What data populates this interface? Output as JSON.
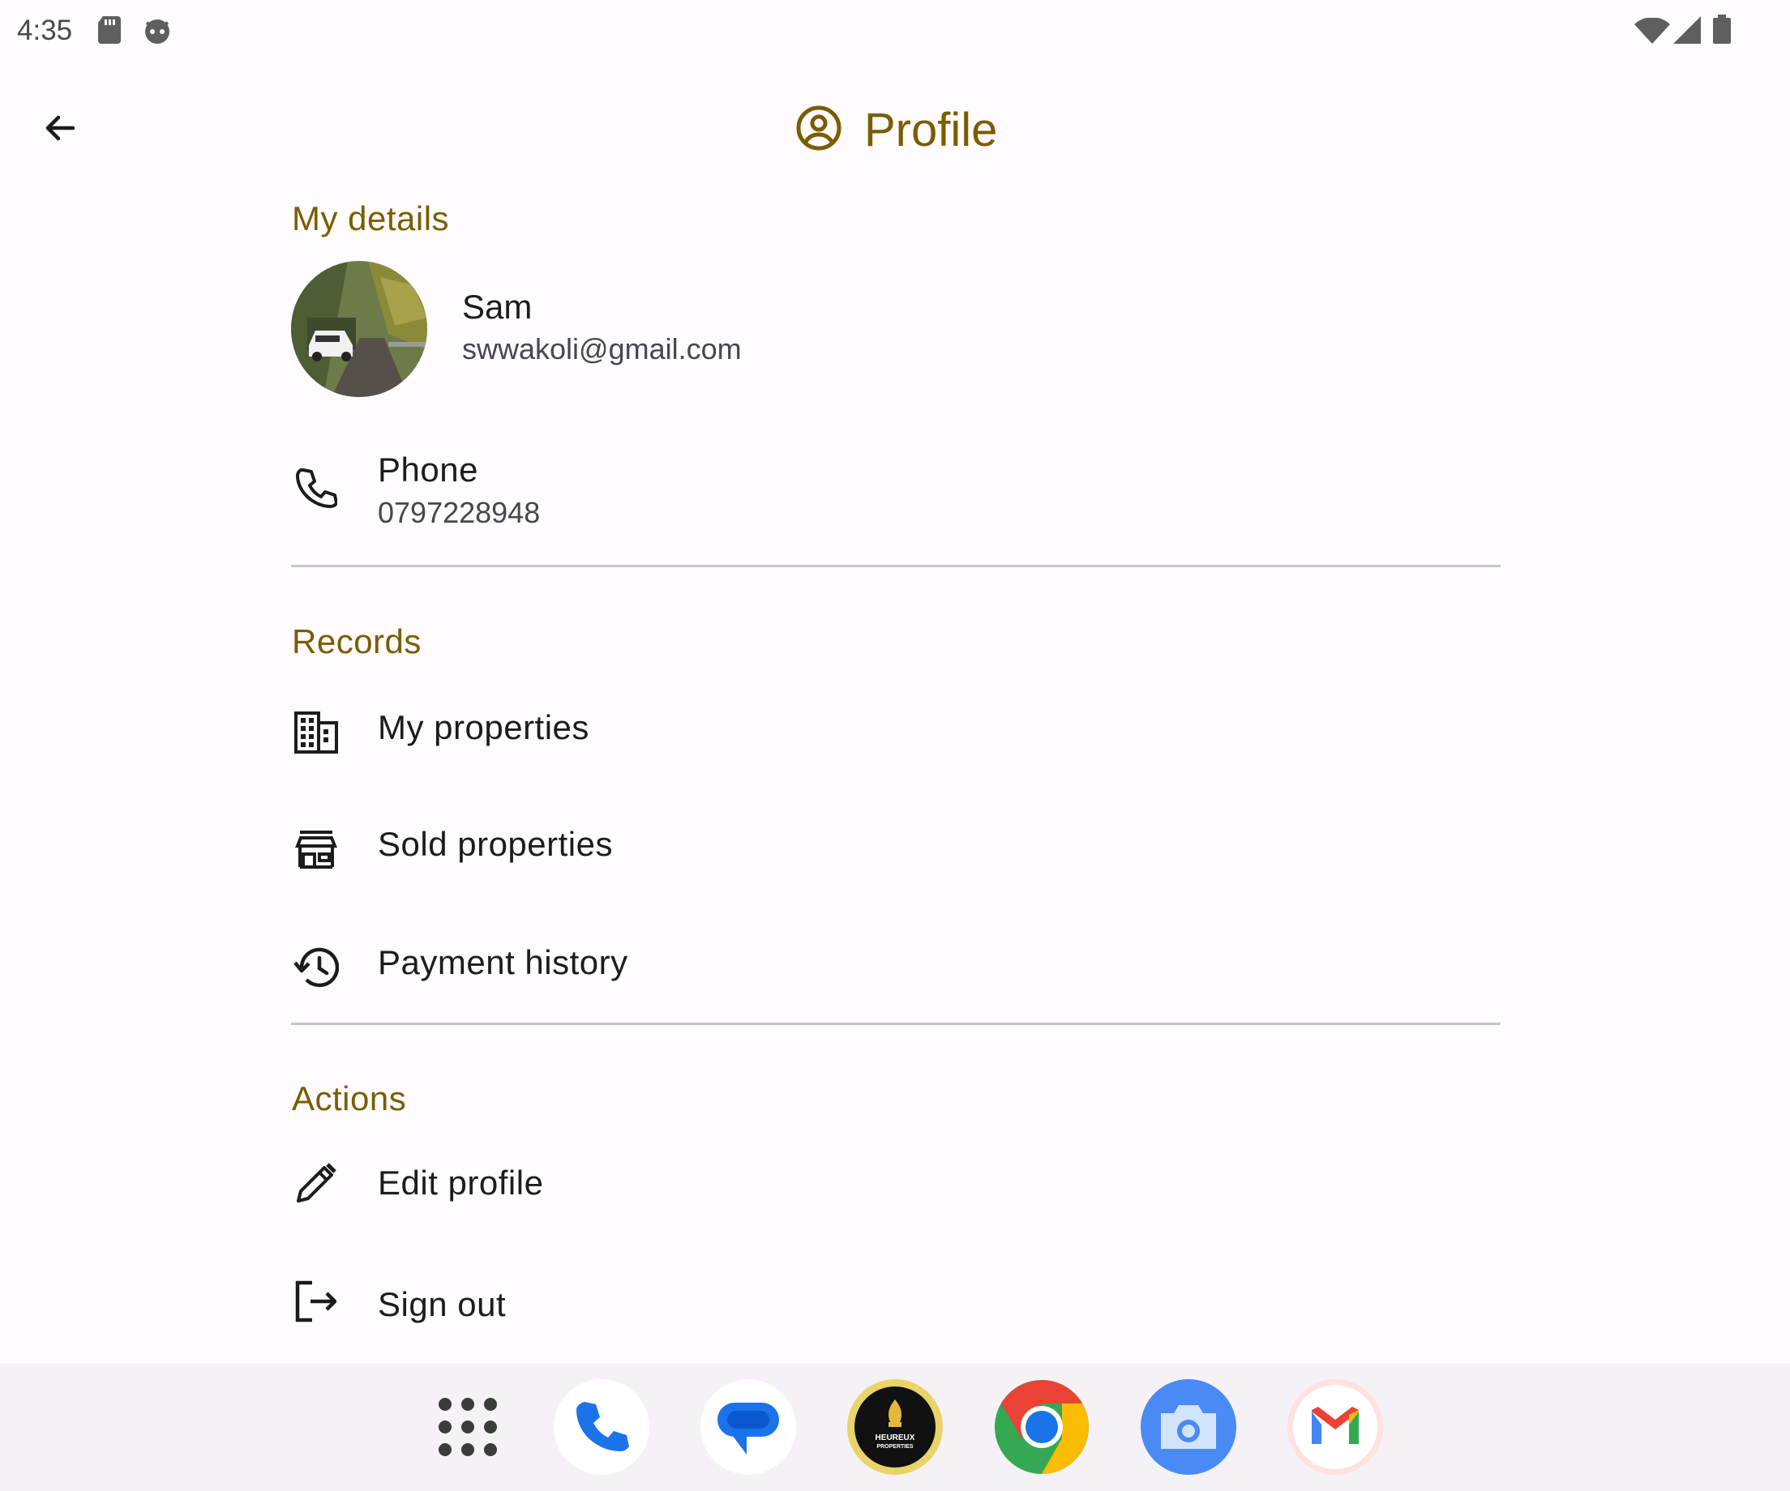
{
  "status_bar": {
    "time": "4:35",
    "left_icons": [
      "sd-card-icon",
      "cat-face-icon"
    ],
    "right_icons": [
      "wifi-icon",
      "signal-icon",
      "battery-icon"
    ]
  },
  "app_bar": {
    "title": "Profile",
    "icons": [
      "back-arrow-icon",
      "account-circle-icon"
    ]
  },
  "my_details": {
    "heading": "My details",
    "name": "Sam",
    "email": "swwakoli@gmail.com",
    "phone_label": "Phone",
    "phone_value": "0797228948"
  },
  "records": {
    "heading": "Records",
    "items": [
      {
        "label": "My properties",
        "icon": "building-icon"
      },
      {
        "label": "Sold properties",
        "icon": "storefront-icon"
      },
      {
        "label": "Payment history",
        "icon": "history-icon"
      }
    ]
  },
  "actions": {
    "heading": "Actions",
    "items": [
      {
        "label": "Edit profile",
        "icon": "pencil-icon"
      },
      {
        "label": "Sign out",
        "icon": "logout-icon"
      }
    ]
  },
  "dock": {
    "apps": [
      "app-drawer-icon",
      "phone-app-icon",
      "messages-app-icon",
      "heureux-properties-app-icon",
      "chrome-app-icon",
      "camera-app-icon",
      "gmail-app-icon"
    ],
    "heureux_logo_text": "HEUREUX PROPERTIES"
  },
  "colors": {
    "accent": "#7a5d00",
    "background": "#fffbfe",
    "divider": "#c8c5ca"
  }
}
